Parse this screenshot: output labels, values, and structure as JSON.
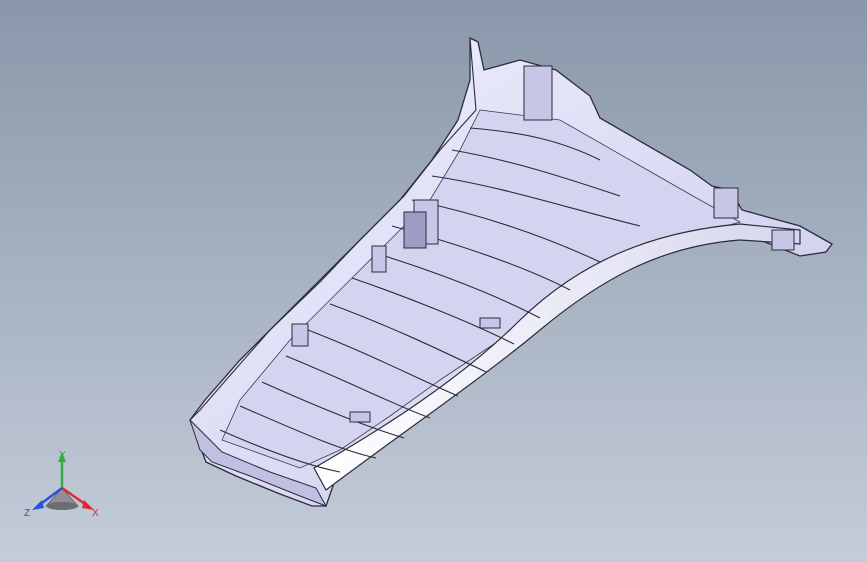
{
  "viewport": {
    "background_top": "#8a97aa",
    "background_bottom": "#c4ccd8"
  },
  "model": {
    "part_fill": "#e6e6fa",
    "shadow_fill": "#b9b9da",
    "edge_color": "#2b2b3a"
  },
  "triad": {
    "x_label": "X",
    "y_label": "Y",
    "z_label": "Z",
    "x_color": "#e0282c",
    "y_color": "#2fae3b",
    "z_color": "#2d4fd6"
  }
}
